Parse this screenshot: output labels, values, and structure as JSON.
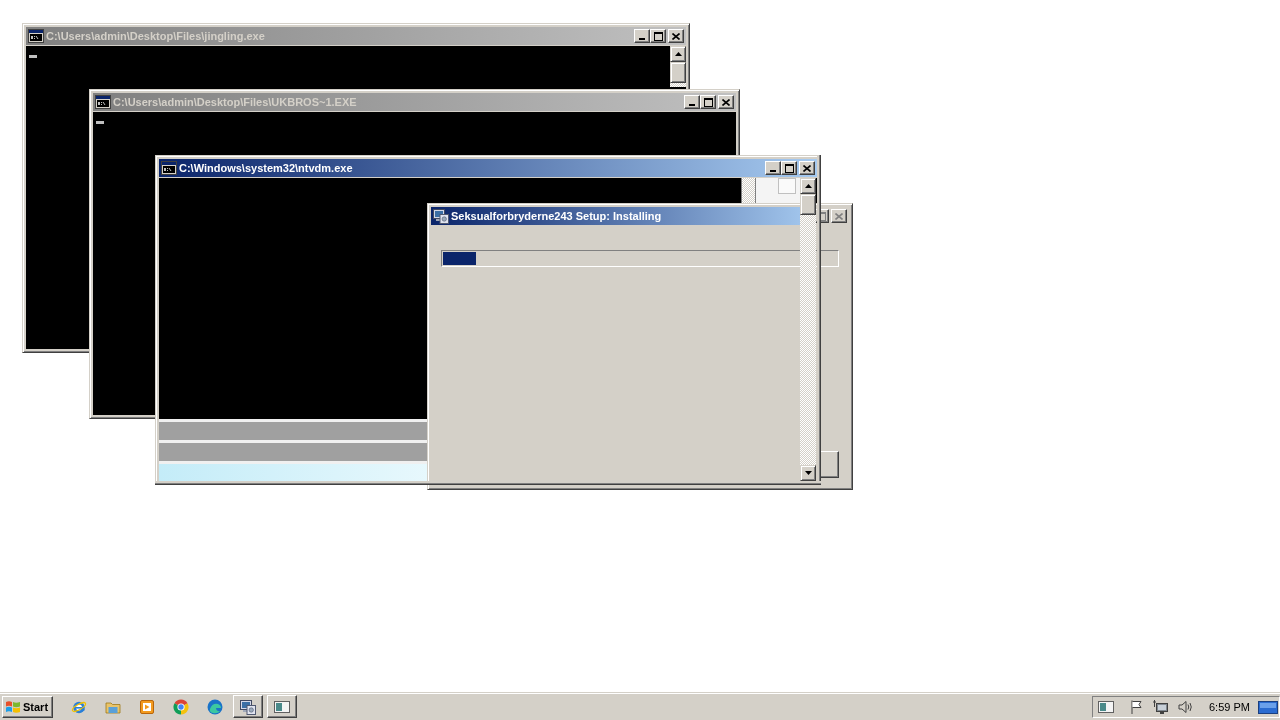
{
  "windows": [
    {
      "kind": "console",
      "title": "C:\\Users\\admin\\Desktop\\Files\\jingling.exe",
      "active": false,
      "cursor": true,
      "buttons": [
        {
          "kind": "minimize",
          "disabled": false
        },
        {
          "kind": "maximize",
          "disabled": false
        },
        {
          "kind": "close",
          "disabled": false
        }
      ]
    },
    {
      "kind": "console",
      "title": "C:\\Users\\admin\\Desktop\\Files\\UKBROS~1.EXE",
      "active": false,
      "cursor": true,
      "buttons": [
        {
          "kind": "minimize",
          "disabled": false
        },
        {
          "kind": "maximize",
          "disabled": false
        },
        {
          "kind": "close",
          "disabled": false
        }
      ]
    },
    {
      "kind": "console",
      "title": "C:\\Windows\\system32\\ntvdm.exe",
      "active": true,
      "cursor": false,
      "buttons": [
        {
          "kind": "minimize",
          "disabled": false
        },
        {
          "kind": "maximize",
          "disabled": false
        },
        {
          "kind": "close",
          "disabled": false
        }
      ]
    },
    {
      "kind": "installer",
      "title": "Seksualforbryderne243 Setup: Installing",
      "active": true,
      "buttons": [
        {
          "kind": "maximize",
          "disabled": true
        },
        {
          "kind": "close",
          "disabled": true
        }
      ],
      "progress": {
        "level": 0.085
      }
    }
  ],
  "taskbar": {
    "start": "Start",
    "clock": "6:59 PM"
  }
}
